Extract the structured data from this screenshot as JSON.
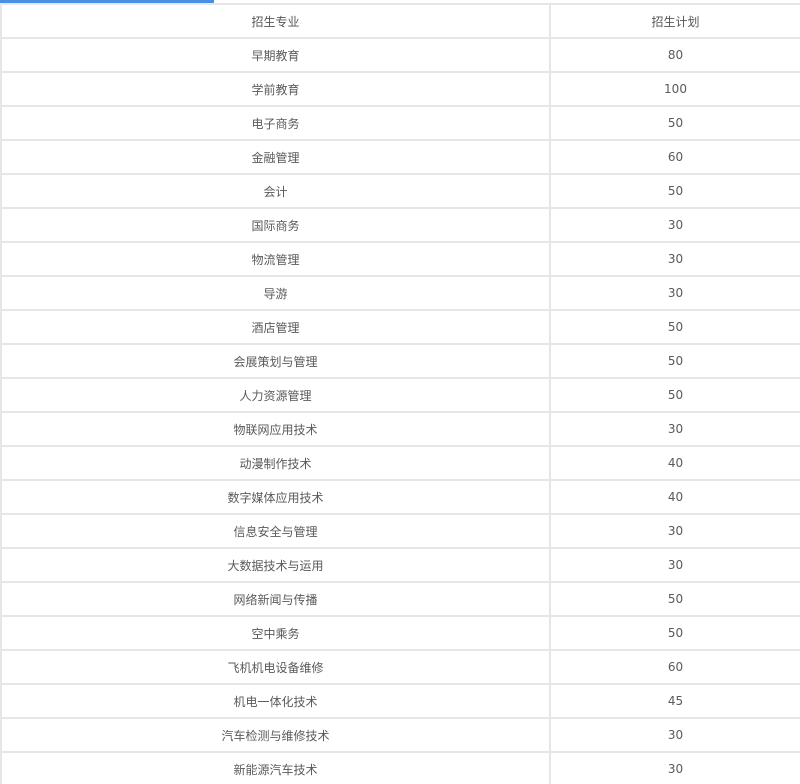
{
  "table": {
    "headers": [
      "招生专业",
      "招生计划"
    ],
    "rows": [
      [
        "早期教育",
        "80"
      ],
      [
        "学前教育",
        "100"
      ],
      [
        "电子商务",
        "50"
      ],
      [
        "金融管理",
        "60"
      ],
      [
        "会计",
        "50"
      ],
      [
        "国际商务",
        "30"
      ],
      [
        "物流管理",
        "30"
      ],
      [
        "导游",
        "30"
      ],
      [
        "酒店管理",
        "50"
      ],
      [
        "会展策划与管理",
        "50"
      ],
      [
        "人力资源管理",
        "50"
      ],
      [
        "物联网应用技术",
        "30"
      ],
      [
        "动漫制作技术",
        "40"
      ],
      [
        "数字媒体应用技术",
        "40"
      ],
      [
        "信息安全与管理",
        "30"
      ],
      [
        "大数据技术与运用",
        "30"
      ],
      [
        "网络新闻与传播",
        "50"
      ],
      [
        "空中乘务",
        "50"
      ],
      [
        "飞机机电设备维修",
        "60"
      ],
      [
        "机电一体化技术",
        "45"
      ],
      [
        "汽车检测与维修技术",
        "30"
      ],
      [
        "新能源汽车技术",
        "30"
      ]
    ]
  },
  "colors": {
    "accent": "#4a90e2",
    "border": "#e6e6e6",
    "text": "#5a5a5a"
  }
}
